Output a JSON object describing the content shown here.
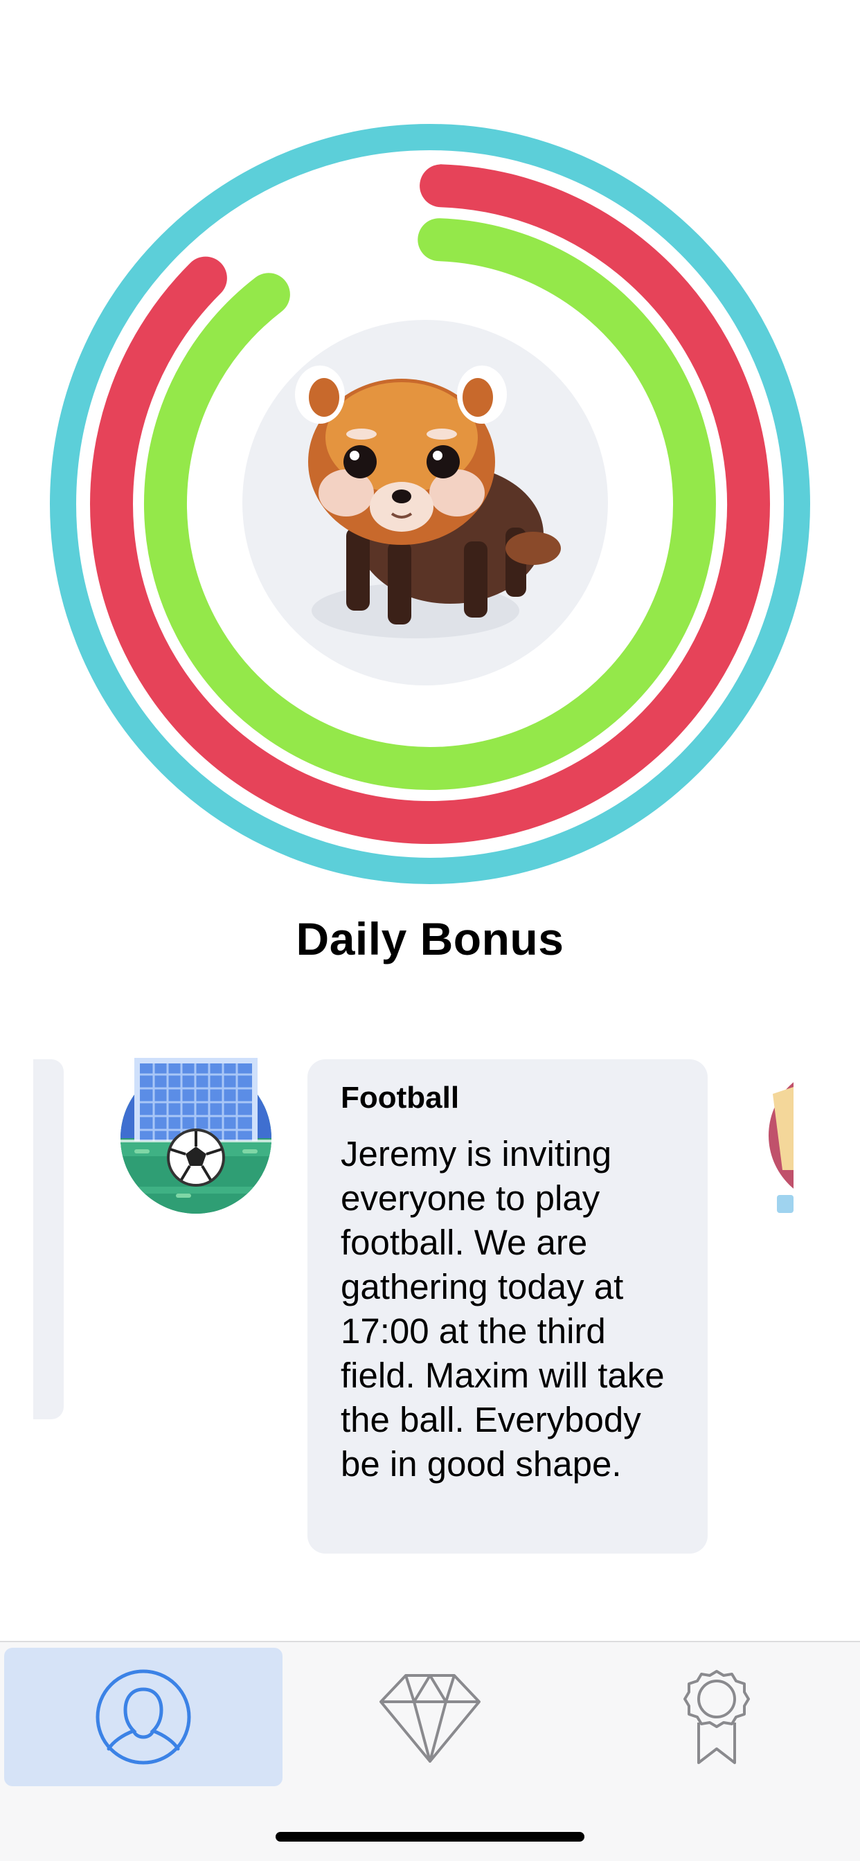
{
  "rings": {
    "outer_color": "#5ccfd9",
    "middle_color": "#e64359",
    "inner_color": "#94e84a",
    "middle_progress": 0.87,
    "inner_progress": 0.89
  },
  "avatar": {
    "icon": "red-panda-icon"
  },
  "title": "Daily Bonus",
  "event": {
    "icon": "football-goal-icon",
    "card_title": "Football",
    "card_body": "Jeremy is inviting everyone to play football. We are gathering today at 17:00 at the third field. Maxim will take the ball. Everybody be in good shape."
  },
  "tabs": [
    {
      "name": "profile",
      "icon": "user-icon",
      "active": true
    },
    {
      "name": "rewards",
      "icon": "diamond-icon",
      "active": false
    },
    {
      "name": "achievements",
      "icon": "award-ribbon-icon",
      "active": false
    }
  ],
  "colors": {
    "active_tab_bg": "#d6e3f7",
    "active_icon": "#3b82e6",
    "inactive_icon": "#8a8a8e"
  }
}
